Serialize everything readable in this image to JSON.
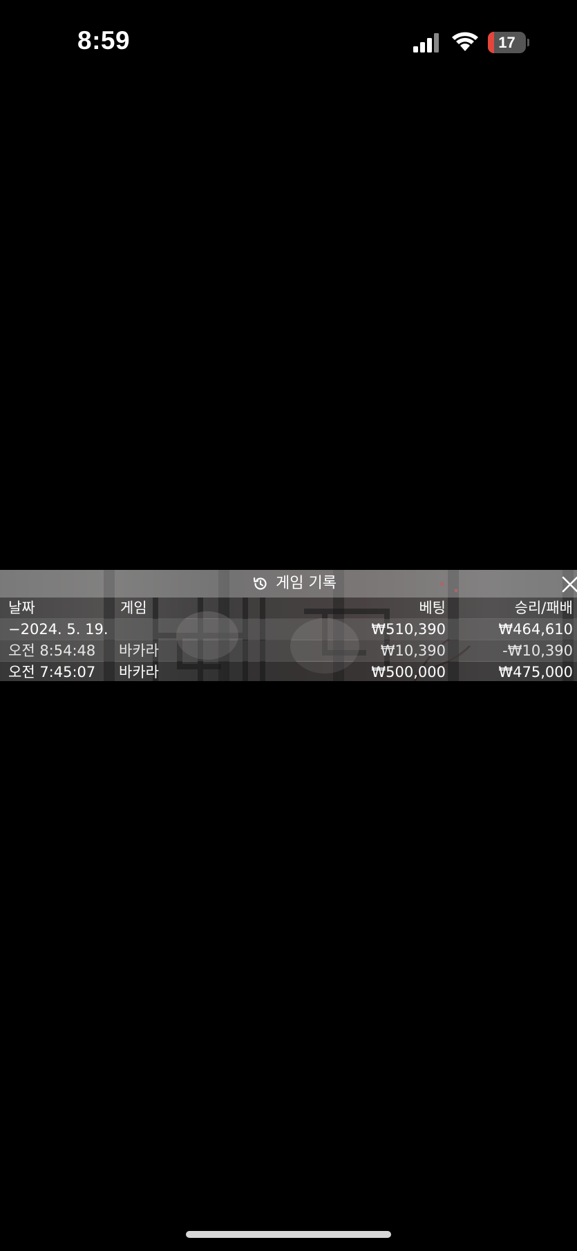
{
  "status_bar": {
    "time": "8:59",
    "battery_level": "17",
    "battery_fraction": 0.17,
    "battery_color": "#e5463b",
    "icons": [
      "cellular-signal-icon",
      "wifi-icon",
      "battery-icon"
    ]
  },
  "history": {
    "title": "게임 기록",
    "title_icon": "history-icon",
    "close_icon": "close-icon",
    "columns": {
      "date": "날짜",
      "game": "게임",
      "bet": "베팅",
      "win_loss": "승리/패배"
    },
    "date_group": {
      "date": "−2024. 5. 19.",
      "bet": "₩510,390",
      "win_loss": "₩464,610"
    },
    "rows": [
      {
        "time": "오전 8:54:48",
        "game": "바카라",
        "bet": "₩10,390",
        "win_loss": "-₩10,390"
      },
      {
        "time": "오전 7:45:07",
        "game": "바카라",
        "bet": "₩500,000",
        "win_loss": "₩475,000"
      }
    ]
  }
}
